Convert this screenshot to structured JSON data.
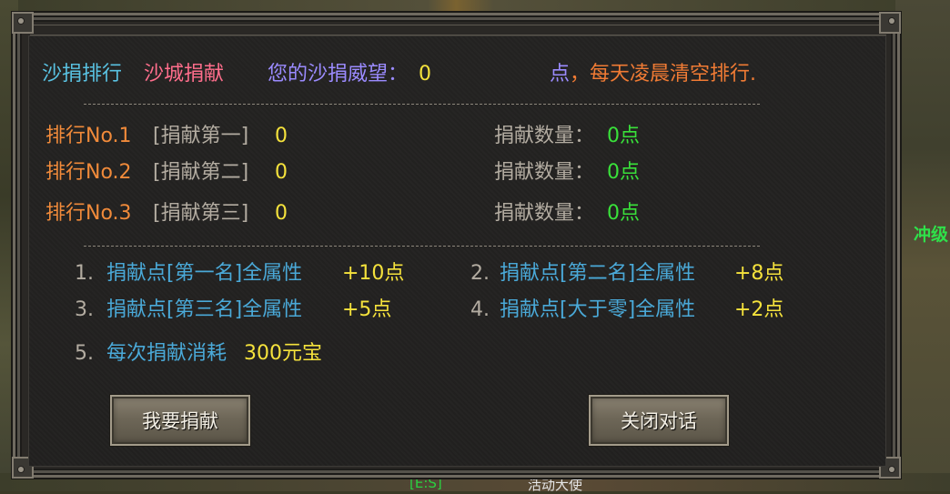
{
  "header": {
    "tab_ranking": "沙捐排行",
    "tab_donate": "沙城捐献",
    "prestige_label": "您的沙捐威望：",
    "prestige_value": "0",
    "notice": "点，每天凌晨清空排行."
  },
  "rankings": [
    {
      "rank_label": "排行No.1",
      "title": "[捐献第一]",
      "name": "0",
      "amount_label": "捐献数量：",
      "amount": "0点"
    },
    {
      "rank_label": "排行No.2",
      "title": "[捐献第二]",
      "name": "0",
      "amount_label": "捐献数量：",
      "amount": "0点"
    },
    {
      "rank_label": "排行No.3",
      "title": "[捐献第三]",
      "name": "0",
      "amount_label": "捐献数量：",
      "amount": "0点"
    }
  ],
  "rewards": [
    {
      "num": "1.",
      "text": "捐献点[第一名]全属性",
      "bonus": "+10点"
    },
    {
      "num": "2.",
      "text": "捐献点[第二名]全属性",
      "bonus": "+8点"
    },
    {
      "num": "3.",
      "text": "捐献点[第三名]全属性",
      "bonus": "+5点"
    },
    {
      "num": "4.",
      "text": "捐献点[大于零]全属性",
      "bonus": "+2点"
    },
    {
      "num": "5.",
      "text": "每次捐献消耗",
      "bonus": "300元宝"
    }
  ],
  "buttons": {
    "donate": "我要捐献",
    "close": "关闭对话"
  },
  "external": {
    "right_edge_text": "冲级",
    "bottom_text_1": "[E:S]",
    "bottom_text_2": "活动大使"
  },
  "colors": {
    "tab_ranking": "#59c2e2",
    "tab_donate": "#ff6e8c",
    "prestige_label": "#9b8bff",
    "value_yellow": "#f5e23c",
    "notice_orange": "#f07b34",
    "rank_orange": "#f08a3a",
    "amount_green": "#39e13a",
    "reward_blue": "#4aa9d8"
  }
}
